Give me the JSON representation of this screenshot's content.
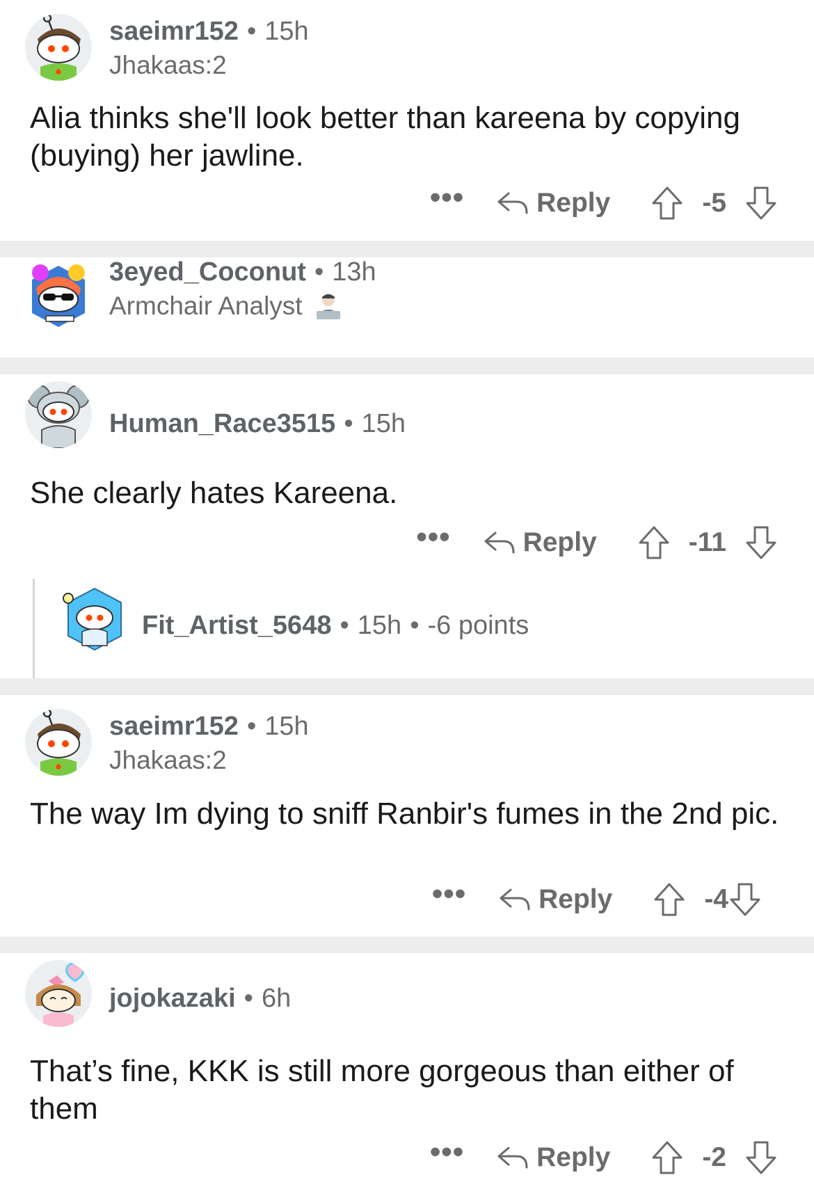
{
  "comments": [
    {
      "username": "saeimr152",
      "age": "15h",
      "flair": "Jhakaas:2",
      "text": "Alia thinks she'll look better than kareena by copying (buying) her jawline.",
      "more": "•••",
      "reply_label": "Reply",
      "score": "-5"
    },
    {
      "username": "3eyed_Coconut",
      "age": "13h",
      "flair": "Armchair Analyst"
    },
    {
      "username": "Human_Race3515",
      "age": "15h",
      "text": "She clearly hates Kareena.",
      "more": "•••",
      "reply_label": "Reply",
      "score": "-11"
    },
    {
      "username": "Fit_Artist_5648",
      "age": "15h",
      "points": "-6 points"
    },
    {
      "username": "saeimr152",
      "age": "15h",
      "flair": "Jhakaas:2",
      "text": "The way Im dying to sniff Ranbir's fumes in the 2nd pic.",
      "more": "•••",
      "reply_label": "Reply",
      "score": "-4"
    },
    {
      "username": "jojokazaki",
      "age": "6h",
      "text": "That’s fine, KKK is still more gorgeous than either of them",
      "more": "•••",
      "reply_label": "Reply",
      "score": "-2"
    }
  ],
  "separator": "•",
  "colors": {
    "background": "#ededed",
    "card": "#ffffff",
    "muted_text": "#6b6b6b",
    "username": "#5f6368",
    "body_text": "#1a1a1b"
  },
  "icons": [
    "reddit-avatar-icon",
    "reply-arrow-icon",
    "upvote-arrow-icon",
    "downvote-arrow-icon",
    "technologist-emoji-icon"
  ]
}
